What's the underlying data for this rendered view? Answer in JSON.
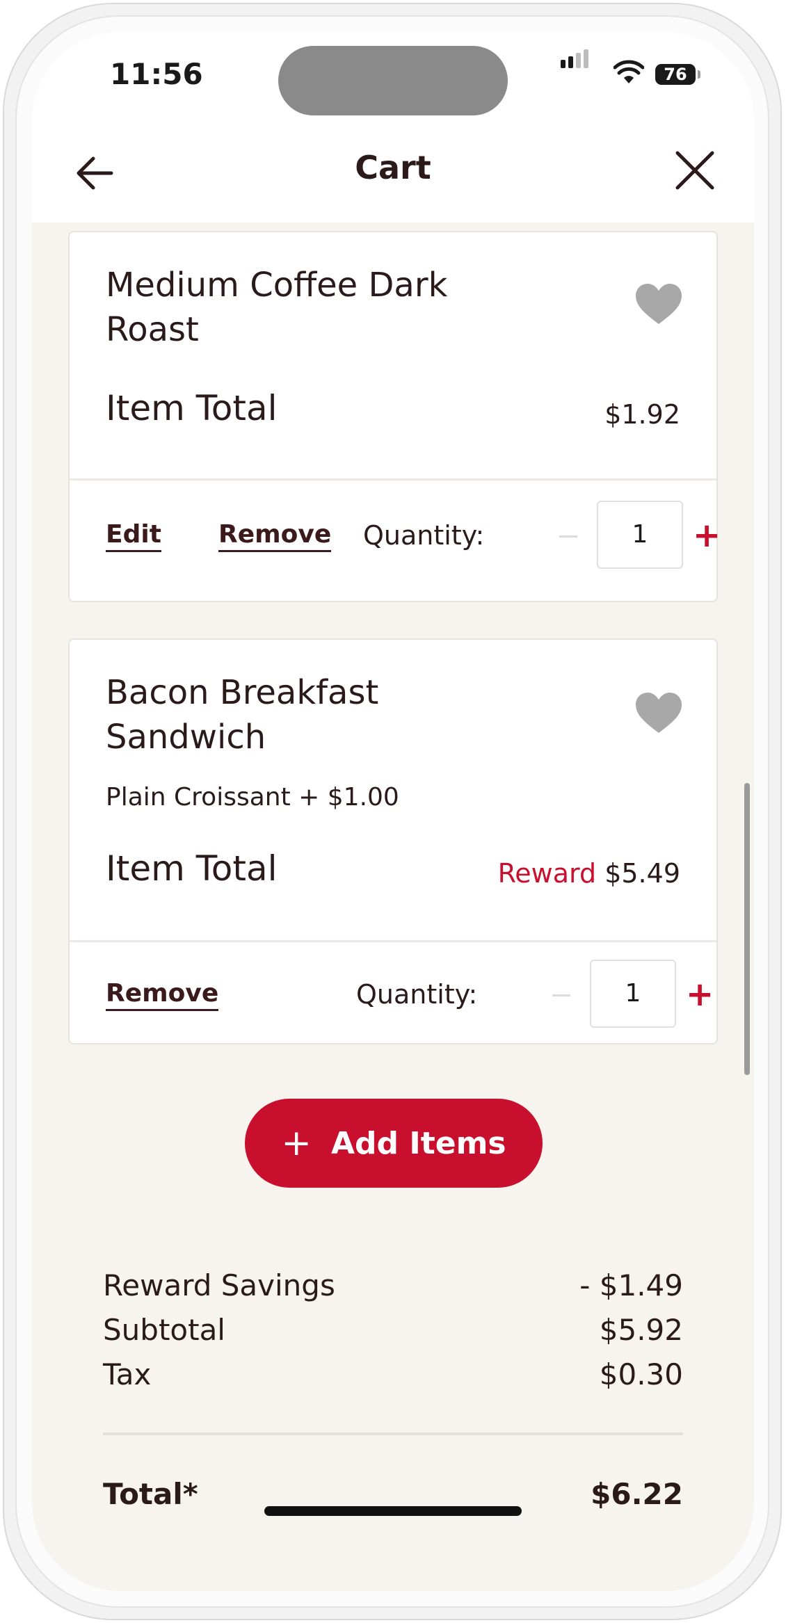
{
  "status_bar": {
    "time": "11:56",
    "battery": "76"
  },
  "header": {
    "title": "Cart",
    "back_icon": "arrow-left-icon",
    "close_icon": "close-icon"
  },
  "cart_items": [
    {
      "name": "Medium Coffee Dark Roast",
      "modifier": "",
      "total_label": "Item Total",
      "reward_label": "",
      "price": "$1.92",
      "edit_label": "Edit",
      "remove_label": "Remove",
      "quantity_label": "Quantity:",
      "quantity": "1",
      "plus": "+"
    },
    {
      "name": "Bacon Breakfast Sandwich",
      "modifier": "Plain Croissant + $1.00",
      "total_label": "Item Total",
      "reward_label": "Reward",
      "price": "$5.49",
      "remove_label": "Remove",
      "quantity_label": "Quantity:",
      "quantity": "1",
      "plus": "+"
    }
  ],
  "add_items": {
    "icon": "+",
    "label": "Add Items"
  },
  "summary": {
    "rows": [
      {
        "label": "Reward Savings",
        "value": "- $1.49"
      },
      {
        "label": "Subtotal",
        "value": "$5.92"
      },
      {
        "label": "Tax",
        "value": "$0.30"
      }
    ],
    "total_label": "Total*",
    "total_value": "$6.22"
  },
  "colors": {
    "accent": "#c8102e",
    "text": "#2a1a1a",
    "background": "#f7f3ee",
    "heart": "#a8a8a8"
  }
}
